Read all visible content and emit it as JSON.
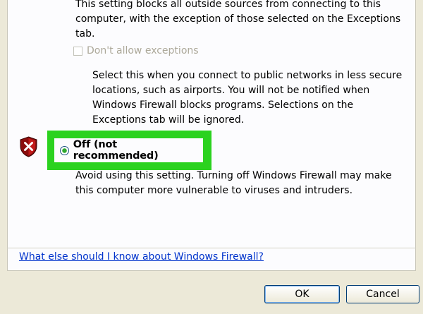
{
  "top_description": "This setting blocks all outside sources from connecting to this computer, with the exception of those selected on the Exceptions tab.",
  "dont_allow": {
    "label": "Don't allow exceptions",
    "checked": false,
    "enabled": false,
    "description": "Select this when you connect to public networks in less secure locations, such as airports. You will not be notified when Windows Firewall blocks programs. Selections on the Exceptions tab will be ignored."
  },
  "off_option": {
    "icon": "shield-warning-icon",
    "label": "Off (not recommended)",
    "selected": true,
    "highlight_color": "#2bd21f",
    "description": "Avoid using this setting. Turning off Windows Firewall may make this computer more vulnerable to viruses and intruders."
  },
  "help_link": "What else should I know about Windows Firewall?",
  "buttons": {
    "ok": "OK",
    "cancel": "Cancel"
  }
}
